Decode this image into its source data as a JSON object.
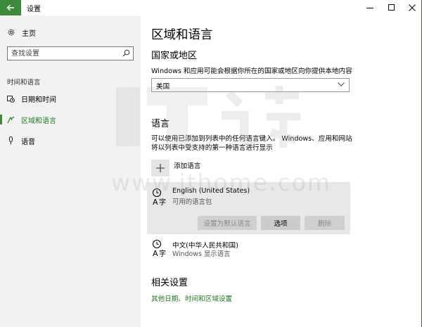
{
  "window": {
    "title": "设置"
  },
  "sidebar": {
    "home_label": "主页",
    "search_placeholder": "查找设置",
    "section_label": "时间和语言",
    "items": [
      {
        "label": "日期和时间",
        "icon": "calendar-clock-icon",
        "active": false
      },
      {
        "label": "区域和语言",
        "icon": "region-language-icon",
        "active": true
      },
      {
        "label": "语音",
        "icon": "microphone-icon",
        "active": false
      }
    ]
  },
  "main": {
    "title": "区域和语言",
    "region": {
      "heading": "国家或地区",
      "description": "Windows 和应用可能会根据你所在的国家或地区向你提供本地内容",
      "selected": "美国"
    },
    "language": {
      "heading": "语言",
      "description_line1": "可以使用已添加到列表中的任何语言键入。 Windows、应用和网站",
      "description_line2": "将以列表中受支持的第一种语言进行显示",
      "add_label": "添加语言",
      "items": [
        {
          "name": "English (United States)",
          "sub": "可用的语言包"
        },
        {
          "name": "中文(中华人民共和国)",
          "sub": "Windows 显示语言"
        }
      ],
      "buttons": {
        "set_default": "设置为默认语言",
        "options": "选项",
        "remove": "删除"
      }
    },
    "related": {
      "heading": "相关设置",
      "link": "其他日期、时间和区域设置"
    }
  },
  "watermark": {
    "text": "www.ithome.com"
  },
  "colors": {
    "accent": "#3d8a3d",
    "link": "#1f7a1f",
    "sidebar_bg": "#f2f2f2"
  }
}
